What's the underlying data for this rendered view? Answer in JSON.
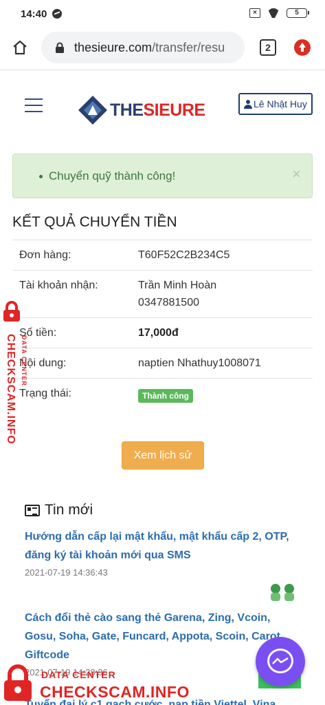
{
  "status_bar": {
    "time": "14:40",
    "battery": "5"
  },
  "browser": {
    "url_host": "thesieure.com",
    "url_path": "/transfer/resu",
    "tab_count": "2"
  },
  "header": {
    "logo_part1": "THE",
    "logo_part2": "SIEURE",
    "user_name": "Lê Nhật Huy"
  },
  "alert": {
    "message": "Chuyển quỹ thành công!",
    "close": "×"
  },
  "result": {
    "title": "KẾT QUẢ CHUYỂN TIỀN",
    "rows": [
      {
        "label": "Đơn hàng:",
        "value": "T60F52C2B234C5"
      },
      {
        "label": "Tài khoản nhận:",
        "value": "Trần Minh Hoàn",
        "value2": "0347881500"
      },
      {
        "label": "Số tiền:",
        "value": "17,000đ"
      },
      {
        "label": "Nội dung:",
        "value": "naptien Nhathuy1008071"
      },
      {
        "label": "Trạng thái:",
        "value": "Thành công"
      }
    ],
    "history_button": "Xem lịch sử"
  },
  "news": {
    "heading": "Tin mới",
    "items": [
      {
        "title": "Hướng dẫn cấp lại mật khẩu, mật khẩu cấp 2, OTP, đăng ký tài khoản mới qua SMS",
        "date": "2021-07-19 14:36:43"
      },
      {
        "title": "Cách đổi thẻ cào sang thẻ Garena, Zing, Vcoin, Gosu, Soha, Gate, Funcard, Appota, Scoin, Carot, Giftcode",
        "date": "2021-07-19 14:28:36"
      },
      {
        "title": "Tuyển đại lý c1 gạch cước, nạp tiền Viettel, Vina"
      }
    ]
  },
  "watermark": {
    "small": "DATA CENTER",
    "big": "CHECKSCAM.INFO"
  },
  "colors": {
    "brand_red": "#e02525",
    "brand_navy": "#2a3f6e",
    "success_green": "#5cb85c",
    "warning_orange": "#f0ad4e",
    "link_blue": "#2b6cb0"
  }
}
